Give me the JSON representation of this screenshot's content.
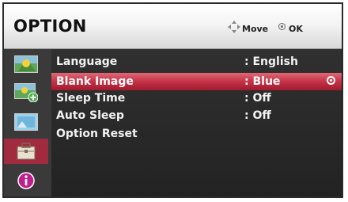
{
  "header": {
    "title": "OPTION",
    "move_label": "Move",
    "ok_label": "OK",
    "move_icon": "four-way-arrow-icon",
    "ok_icon": "ok-circle-icon"
  },
  "sidebar": {
    "items": [
      {
        "icon": "picture-icon"
      },
      {
        "icon": "picture-adjust-icon"
      },
      {
        "icon": "screen-icon"
      },
      {
        "icon": "option-toolbox-icon",
        "active": true
      },
      {
        "icon": "info-icon"
      }
    ]
  },
  "menu": {
    "items": [
      {
        "label": "Language",
        "value": ": English",
        "selected": false
      },
      {
        "label": "Blank Image",
        "value": ": Blue",
        "selected": true
      },
      {
        "label": "Sleep Time",
        "value": ": Off",
        "selected": false
      },
      {
        "label": "Auto Sleep",
        "value": ": Off",
        "selected": false
      },
      {
        "label": "Option Reset",
        "value": "",
        "selected": false
      }
    ]
  },
  "colors": {
    "highlight": "#c53247",
    "sidebar_active": "#a22a3e",
    "background": "#2c2c2c"
  }
}
